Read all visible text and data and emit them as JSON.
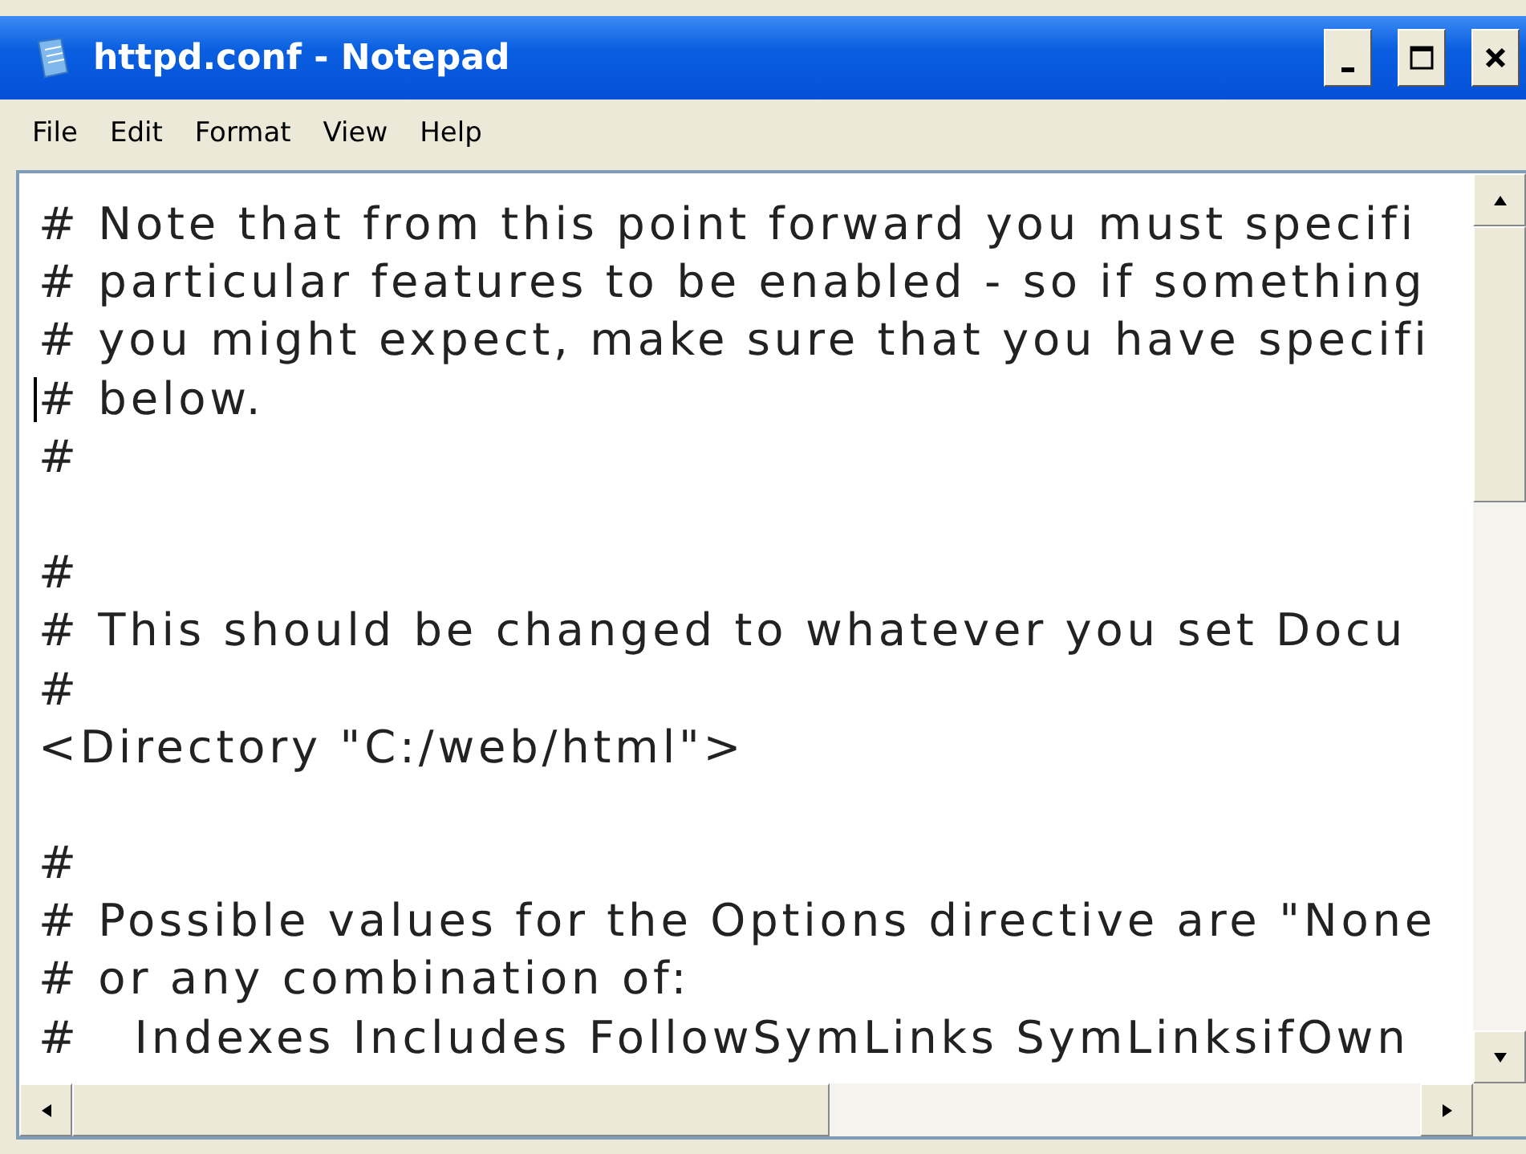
{
  "window": {
    "title": "httpd.conf - Notepad"
  },
  "menu": [
    "File",
    "Edit",
    "Format",
    "View",
    "Help"
  ],
  "lines": [
    {
      "kind": "text",
      "text": "# Note that from this point forward you must specifi"
    },
    {
      "kind": "text",
      "text": "# particular features to be enabled - so if something"
    },
    {
      "kind": "text",
      "text": "# you might expect, make sure that you have specifi"
    },
    {
      "kind": "cursor",
      "text": "# below."
    },
    {
      "kind": "text",
      "text": "#"
    },
    {
      "kind": "blank"
    },
    {
      "kind": "text",
      "text": "#"
    },
    {
      "kind": "text",
      "text": "# This should be changed to whatever you set Docu"
    },
    {
      "kind": "text",
      "text": "#"
    },
    {
      "kind": "text",
      "text": "<Directory \"C:/web/html\">"
    },
    {
      "kind": "blank"
    },
    {
      "kind": "text",
      "text": "#"
    },
    {
      "kind": "text",
      "text": "# Possible values for the Options directive are \"None"
    },
    {
      "kind": "text",
      "text": "# or any combination of:"
    },
    {
      "kind": "text",
      "text": "#   Indexes Includes FollowSymLinks SymLinksifOwn"
    }
  ]
}
